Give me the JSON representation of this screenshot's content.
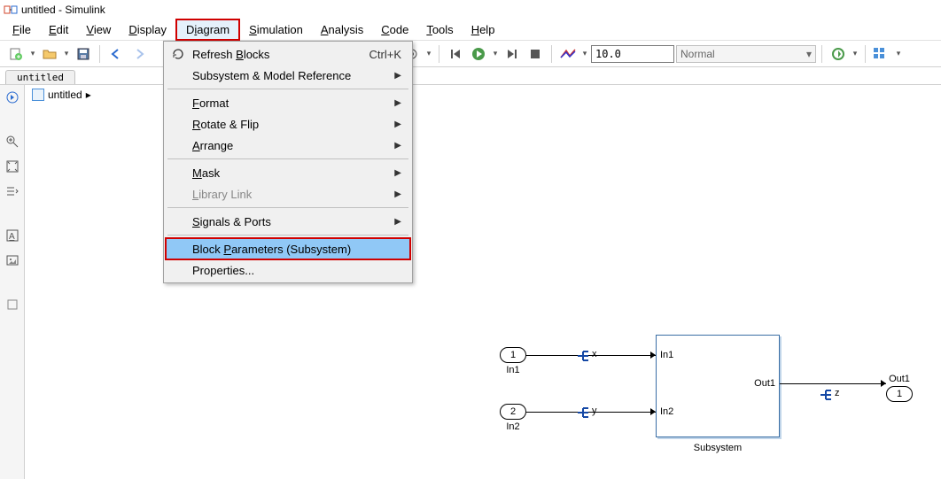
{
  "app": {
    "title": "untitled - Simulink"
  },
  "menu": {
    "file": "File",
    "edit": "Edit",
    "view": "View",
    "display": "Display",
    "diagram": "Diagram",
    "simulation": "Simulation",
    "analysis": "Analysis",
    "code": "Code",
    "tools": "Tools",
    "help": "Help"
  },
  "toolbar": {
    "simtime": "10.0",
    "mode": "Normal"
  },
  "tab": {
    "name": "untitled"
  },
  "crumb": {
    "path": "untitled",
    "sep": "▸"
  },
  "dropdown": {
    "refresh": "Refresh Blocks",
    "refresh_shortcut": "Ctrl+K",
    "subsysref": "Subsystem & Model Reference",
    "format": "Format",
    "rotateflip": "Rotate & Flip",
    "arrange": "Arrange",
    "mask": "Mask",
    "liblink": "Library Link",
    "sigports": "Signals & Ports",
    "blockparams": "Block Parameters (Subsystem)",
    "properties": "Properties..."
  },
  "model": {
    "in1_num": "1",
    "in1_label": "In1",
    "in2_num": "2",
    "in2_label": "In2",
    "out1_num": "1",
    "out1_label": "Out1",
    "sub_in1": "In1",
    "sub_in2": "In2",
    "sub_out1": "Out1",
    "sub_label": "Subsystem",
    "sig_x": "x",
    "sig_y": "y",
    "sig_z": "z"
  }
}
